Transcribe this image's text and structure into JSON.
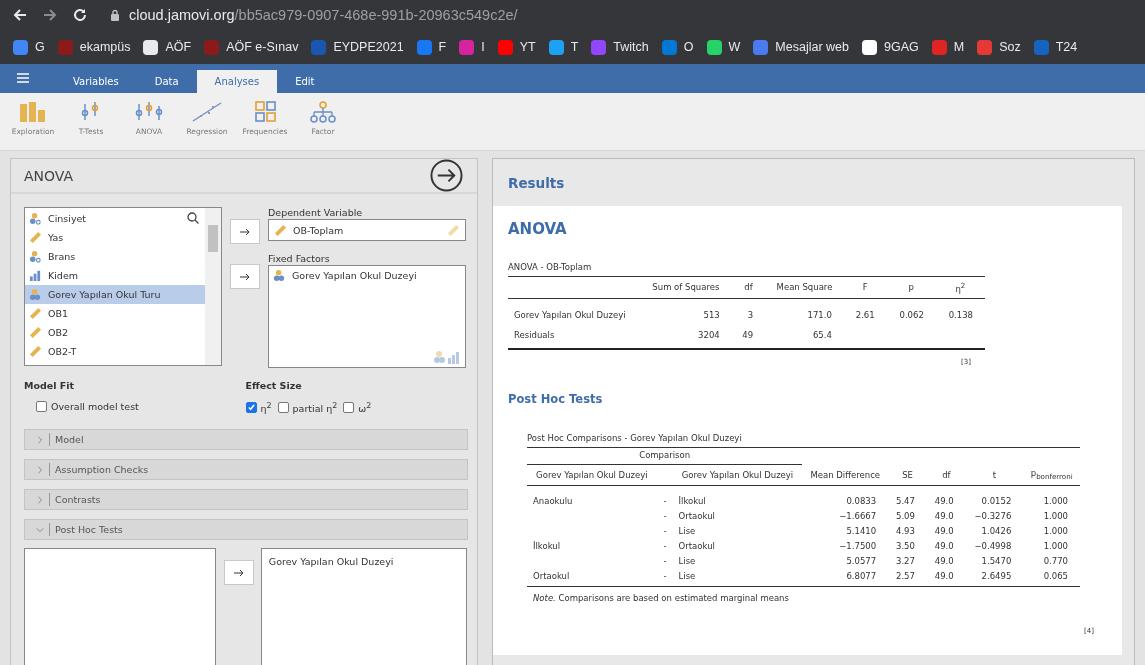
{
  "browser": {
    "url_host": "cloud.jamovi.org",
    "url_path": "/bb5ac979-0907-468e-991b-20963c549c2e/"
  },
  "bookmarks": [
    {
      "label": "G",
      "color": "#4285f4"
    },
    {
      "label": "ekampüs",
      "color": "#8b1a1a"
    },
    {
      "label": "AÖF",
      "color": "#e8eaed"
    },
    {
      "label": "AÖF e-Sınav",
      "color": "#8b1a1a"
    },
    {
      "label": "EYDPE2021",
      "color": "#1a56b0"
    },
    {
      "label": "F",
      "color": "#1877f2"
    },
    {
      "label": "I",
      "color": "#d6249f"
    },
    {
      "label": "YT",
      "color": "#ff0000"
    },
    {
      "label": "T",
      "color": "#1da1f2"
    },
    {
      "label": "Twitch",
      "color": "#9146ff"
    },
    {
      "label": "O",
      "color": "#0078d4"
    },
    {
      "label": "W",
      "color": "#25d366"
    },
    {
      "label": "Mesajlar web",
      "color": "#4a7cf0"
    },
    {
      "label": "9GAG",
      "color": "#ffffff"
    },
    {
      "label": "M",
      "color": "#e02424"
    },
    {
      "label": "Soz",
      "color": "#e53935"
    },
    {
      "label": "T24",
      "color": "#1565c0"
    }
  ],
  "menu_tabs": [
    {
      "label": "Variables",
      "selected": false
    },
    {
      "label": "Data",
      "selected": false
    },
    {
      "label": "Analyses",
      "selected": true
    },
    {
      "label": "Edit",
      "selected": false
    }
  ],
  "ribbon": [
    {
      "label": "Exploration",
      "kind": "bars"
    },
    {
      "label": "T-Tests",
      "kind": "ttest"
    },
    {
      "label": "ANOVA",
      "kind": "anova"
    },
    {
      "label": "Regression",
      "kind": "regression"
    },
    {
      "label": "Frequencies",
      "kind": "grid"
    },
    {
      "label": "Factor",
      "kind": "tree"
    }
  ],
  "analysis": {
    "title": "ANOVA",
    "variables": [
      {
        "name": "Cinsiyet",
        "kind": "nominal-text",
        "selected": false
      },
      {
        "name": "Yas",
        "kind": "continuous",
        "selected": false
      },
      {
        "name": "Brans",
        "kind": "nominal-text",
        "selected": false
      },
      {
        "name": "Kidem",
        "kind": "ordinal",
        "selected": false
      },
      {
        "name": "Gorev Yapılan Okul Turu",
        "kind": "nominal",
        "selected": true
      },
      {
        "name": "OB1",
        "kind": "continuous",
        "selected": false
      },
      {
        "name": "OB2",
        "kind": "continuous",
        "selected": false
      },
      {
        "name": "OB2-T",
        "kind": "continuous",
        "selected": false
      }
    ],
    "dependent_label": "Dependent Variable",
    "dependent": {
      "name": "OB-Toplam",
      "kind": "continuous"
    },
    "factors_label": "Fixed Factors",
    "factors": [
      {
        "name": "Gorev Yapılan Okul Duzeyi",
        "kind": "nominal"
      }
    ],
    "model_fit": {
      "title": "Model Fit",
      "options": [
        {
          "label": "Overall model test",
          "checked": false
        }
      ]
    },
    "effect_size": {
      "title": "Effect Size",
      "options": [
        {
          "label": "η$^{2}$",
          "checked": true
        },
        {
          "label": "partial η$^{2}$",
          "checked": false
        },
        {
          "label": "ω$^{2}$",
          "checked": false
        }
      ]
    },
    "sections": [
      {
        "label": "Model",
        "expanded": false
      },
      {
        "label": "Assumption Checks",
        "expanded": false
      },
      {
        "label": "Contrasts",
        "expanded": false
      },
      {
        "label": "Post Hoc Tests",
        "expanded": true
      }
    ],
    "post_hoc_selected": [
      "Gorev Yapılan Okul Duzeyi"
    ]
  },
  "results": {
    "title": "Results",
    "heading": "ANOVA",
    "anova_table": {
      "title": "ANOVA - OB-Toplam",
      "columns": [
        "Sum of Squares",
        "df",
        "Mean Square",
        "F",
        "p",
        "η$^{2}$"
      ],
      "rows": [
        {
          "term": "Gorev Yapılan Okul Duzeyi",
          "cells": [
            "513",
            "3",
            "171.0",
            "2.61",
            "0.062",
            "0.138"
          ]
        },
        {
          "term": "Residuals",
          "cells": [
            "3204",
            "49",
            "65.4"
          ]
        }
      ],
      "footnote": "[3]"
    },
    "post_hoc_heading": "Post Hoc Tests",
    "post_hoc_table": {
      "title": "Post Hoc Comparisons - Gorev Yapılan Okul Duzeyi",
      "group_header": "Comparison",
      "columns": [
        "Gorev Yapılan Okul Duzeyi",
        "",
        "Gorev Yapılan Okul Duzeyi",
        "Mean Difference",
        "SE",
        "df",
        "t",
        "p$_{bonferroni}$"
      ],
      "rows": [
        [
          "Anaokulu",
          "-",
          "İlkokul",
          "0.0833",
          "5.47",
          "49.0",
          "0.0152",
          "1.000"
        ],
        [
          "",
          "-",
          "Ortaokul",
          "−1.6667",
          "5.09",
          "49.0",
          "−0.3276",
          "1.000"
        ],
        [
          "",
          "-",
          "Lise",
          "5.1410",
          "4.93",
          "49.0",
          "1.0426",
          "1.000"
        ],
        [
          "İlkokul",
          "-",
          "Ortaokul",
          "−1.7500",
          "3.50",
          "49.0",
          "−0.4998",
          "1.000"
        ],
        [
          "",
          "-",
          "Lise",
          "5.0577",
          "3.27",
          "49.0",
          "1.5470",
          "0.770"
        ],
        [
          "Ortaokul",
          "-",
          "Lise",
          "6.8077",
          "2.57",
          "49.0",
          "2.6495",
          "0.065"
        ]
      ],
      "note": "*Note.* Comparisons are based on estimated marginal means",
      "footnote": "[4]"
    }
  }
}
